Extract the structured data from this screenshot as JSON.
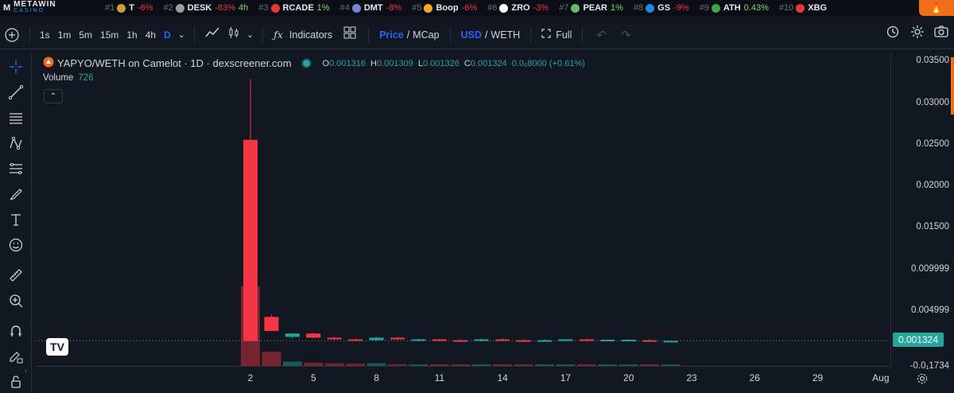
{
  "brand": {
    "name": "METAWIN",
    "sub": "CASINO",
    "mark": "M"
  },
  "ticker": [
    {
      "rank": "#1",
      "symbol": "T",
      "change": "-6%",
      "dir": "down",
      "color": "#c8a040"
    },
    {
      "rank": "#2",
      "symbol": "DESK",
      "change": "-83%",
      "dir": "down",
      "change2": "4h",
      "color": "#9e9e9e"
    },
    {
      "rank": "#3",
      "symbol": "RCADE",
      "change": "1%",
      "dir": "up",
      "color": "#e53935"
    },
    {
      "rank": "#4",
      "symbol": "DMT",
      "change": "-8%",
      "dir": "down",
      "color": "#7986cb"
    },
    {
      "rank": "#5",
      "symbol": "Boop",
      "change": "-6%",
      "dir": "down",
      "color": "#f9a825"
    },
    {
      "rank": "#6",
      "symbol": "ZRO",
      "change": "-3%",
      "dir": "down",
      "color": "#ffffff"
    },
    {
      "rank": "#7",
      "symbol": "PEAR",
      "change": "1%",
      "dir": "up",
      "color": "#66bb6a"
    },
    {
      "rank": "#8",
      "symbol": "GS",
      "change": "-9%",
      "dir": "down",
      "color": "#1e88e5"
    },
    {
      "rank": "#9",
      "symbol": "ATH",
      "change": "0.43%",
      "dir": "up",
      "color": "#43a047"
    },
    {
      "rank": "#10",
      "symbol": "XBG",
      "change": "",
      "dir": "down",
      "color": "#e53935"
    }
  ],
  "toolbar": {
    "timeframes": [
      "1s",
      "1m",
      "5m",
      "15m",
      "1h",
      "4h",
      "D"
    ],
    "active_timeframe": "D",
    "indicators_label": "Indicators",
    "price_label": "Price",
    "mcap_label": "MCap",
    "usd_label": "USD",
    "weth_label": "WETH",
    "full_label": "Full",
    "slash": "/"
  },
  "legend": {
    "pair": "YAPYO/WETH on Camelot · 1D · dexscreener.com",
    "ohlc": [
      {
        "key": "O",
        "value": "0.001316"
      },
      {
        "key": "H",
        "value": "0.001309"
      },
      {
        "key": "L",
        "value": "0.001326"
      },
      {
        "key": "C",
        "value": "0.001324"
      }
    ],
    "change": "0.0₅8000 (+0.61%)",
    "volume_label": "Volume",
    "volume_value": "726"
  },
  "price_axis": [
    "0.03500",
    "0.03000",
    "0.02500",
    "0.02000",
    "0.01500",
    "0.009999",
    "0.004999",
    "-0.0₁1734"
  ],
  "last_price": "0.001324",
  "time_axis": [
    "2",
    "5",
    "8",
    "11",
    "14",
    "17",
    "20",
    "23",
    "26",
    "29",
    "Aug"
  ],
  "chart_data": {
    "type": "candlestick",
    "title": "YAPYO/WETH on Camelot · 1D · dexscreener.com",
    "x": [
      2,
      3,
      4,
      5,
      6,
      7,
      8,
      9,
      10,
      11,
      12,
      13,
      14,
      15,
      16,
      17,
      18,
      19,
      20,
      21,
      22
    ],
    "candles": [
      {
        "x": 2,
        "open": 0.0255,
        "high": 0.0328,
        "low": 0.0013,
        "close": 0.0013,
        "dir": "down"
      },
      {
        "x": 3,
        "open": 0.0042,
        "high": 0.0045,
        "low": 0.0025,
        "close": 0.0025,
        "dir": "down"
      },
      {
        "x": 4,
        "open": 0.0018,
        "high": 0.0022,
        "low": 0.0016,
        "close": 0.0022,
        "dir": "up"
      },
      {
        "x": 5,
        "open": 0.0022,
        "high": 0.0023,
        "low": 0.0016,
        "close": 0.0017,
        "dir": "down"
      },
      {
        "x": 6,
        "open": 0.0017,
        "high": 0.0018,
        "low": 0.0014,
        "close": 0.0015,
        "dir": "down"
      },
      {
        "x": 7,
        "open": 0.0015,
        "high": 0.0016,
        "low": 0.0013,
        "close": 0.0014,
        "dir": "down"
      },
      {
        "x": 8,
        "open": 0.0014,
        "high": 0.0018,
        "low": 0.0013,
        "close": 0.0017,
        "dir": "up"
      },
      {
        "x": 9,
        "open": 0.0017,
        "high": 0.0018,
        "low": 0.0014,
        "close": 0.0015,
        "dir": "down"
      },
      {
        "x": 10,
        "open": 0.0014,
        "high": 0.0016,
        "low": 0.0013,
        "close": 0.0015,
        "dir": "up"
      },
      {
        "x": 11,
        "open": 0.0015,
        "high": 0.0016,
        "low": 0.0013,
        "close": 0.0014,
        "dir": "down"
      },
      {
        "x": 12,
        "open": 0.0014,
        "high": 0.0015,
        "low": 0.0013,
        "close": 0.00135,
        "dir": "down"
      },
      {
        "x": 13,
        "open": 0.00135,
        "high": 0.0016,
        "low": 0.0013,
        "close": 0.0015,
        "dir": "up"
      },
      {
        "x": 14,
        "open": 0.0015,
        "high": 0.0016,
        "low": 0.0013,
        "close": 0.0014,
        "dir": "down"
      },
      {
        "x": 15,
        "open": 0.0014,
        "high": 0.0015,
        "low": 0.0013,
        "close": 0.0013,
        "dir": "down"
      },
      {
        "x": 16,
        "open": 0.0013,
        "high": 0.0015,
        "low": 0.0013,
        "close": 0.0014,
        "dir": "up"
      },
      {
        "x": 17,
        "open": 0.0014,
        "high": 0.0015,
        "low": 0.0013,
        "close": 0.0015,
        "dir": "up"
      },
      {
        "x": 18,
        "open": 0.0015,
        "high": 0.0016,
        "low": 0.0013,
        "close": 0.0014,
        "dir": "down"
      },
      {
        "x": 19,
        "open": 0.0014,
        "high": 0.0015,
        "low": 0.0013,
        "close": 0.00145,
        "dir": "up"
      },
      {
        "x": 20,
        "open": 0.00145,
        "high": 0.0015,
        "low": 0.0013,
        "close": 0.0014,
        "dir": "up"
      },
      {
        "x": 21,
        "open": 0.0014,
        "high": 0.0015,
        "low": 0.0013,
        "close": 0.00132,
        "dir": "down"
      },
      {
        "x": 22,
        "open": 0.001316,
        "high": 0.00133,
        "low": 0.0013,
        "close": 0.001324,
        "dir": "up"
      }
    ],
    "volume": [
      {
        "x": 2,
        "value": 726,
        "dir": "down"
      },
      {
        "x": 3,
        "value": 130,
        "dir": "down"
      },
      {
        "x": 4,
        "value": 40,
        "dir": "up"
      },
      {
        "x": 5,
        "value": 30,
        "dir": "down"
      },
      {
        "x": 6,
        "value": 25,
        "dir": "down"
      },
      {
        "x": 7,
        "value": 20,
        "dir": "down"
      },
      {
        "x": 8,
        "value": 25,
        "dir": "up"
      },
      {
        "x": 9,
        "value": 15,
        "dir": "down"
      },
      {
        "x": 10,
        "value": 12,
        "dir": "up"
      },
      {
        "x": 11,
        "value": 10,
        "dir": "down"
      },
      {
        "x": 12,
        "value": 10,
        "dir": "down"
      },
      {
        "x": 13,
        "value": 15,
        "dir": "up"
      },
      {
        "x": 14,
        "value": 10,
        "dir": "down"
      },
      {
        "x": 15,
        "value": 10,
        "dir": "down"
      },
      {
        "x": 16,
        "value": 8,
        "dir": "up"
      },
      {
        "x": 17,
        "value": 8,
        "dir": "up"
      },
      {
        "x": 18,
        "value": 10,
        "dir": "down"
      },
      {
        "x": 19,
        "value": 8,
        "dir": "up"
      },
      {
        "x": 20,
        "value": 8,
        "dir": "up"
      },
      {
        "x": 21,
        "value": 6,
        "dir": "down"
      },
      {
        "x": 22,
        "value": 5,
        "dir": "up"
      }
    ],
    "ylim": [
      -0.0017,
      0.036
    ],
    "xlim": [
      0,
      33
    ],
    "colors": {
      "up": "#26a69a",
      "down": "#f23645",
      "last_line": "#26a69a"
    }
  }
}
